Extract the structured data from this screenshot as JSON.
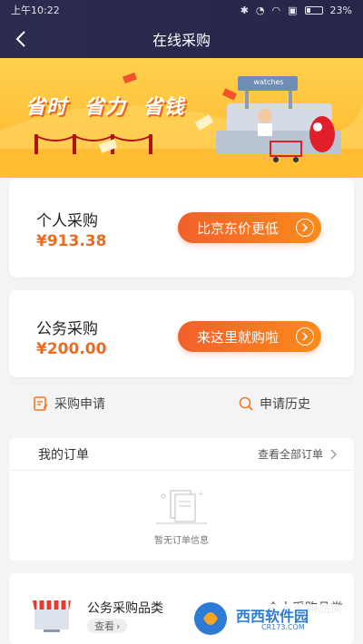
{
  "status": {
    "time": "上午10:22",
    "battery": "23%"
  },
  "nav": {
    "title": "在线采购"
  },
  "banner": {
    "slogan": [
      "省时",
      "省力",
      "省钱"
    ],
    "shop_sign": "watches"
  },
  "personal": {
    "title": "个人采购",
    "amount": "¥913.38",
    "button": "比京东价更低"
  },
  "public": {
    "title": "公务采购",
    "amount": "¥200.00",
    "button": "来这里就购啦"
  },
  "actions": {
    "apply": "采购申请",
    "history": "申请历史"
  },
  "orders": {
    "title": "我的订单",
    "view_all": "查看全部订单",
    "empty": "暂无订单信息"
  },
  "category": {
    "title": "公务采购品类",
    "view": "查看",
    "right_title": "个人采购品类"
  },
  "watermark": {
    "brand": "西西软件园",
    "url": "CR173.COM"
  },
  "colors": {
    "accent": "#f06a1d",
    "header": "#2b2c4f",
    "banner": "#ffc23a"
  }
}
